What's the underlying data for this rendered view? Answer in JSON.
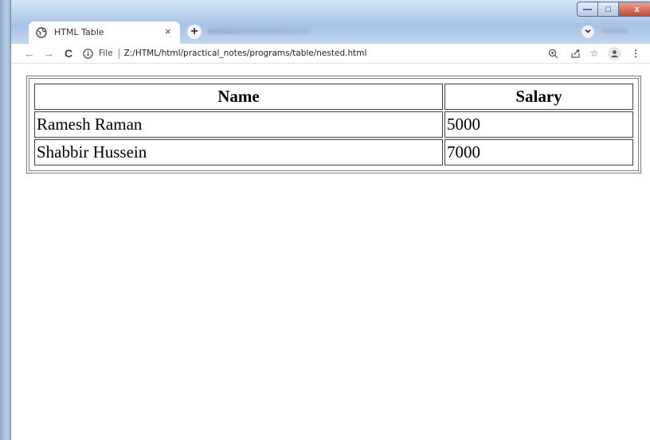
{
  "browser": {
    "tab": {
      "title": "HTML Table",
      "close_glyph": "×"
    },
    "new_tab_glyph": "+",
    "toolbar": {
      "back_glyph": "←",
      "forward_glyph": "→",
      "reload_glyph": "C",
      "scheme_label": "File",
      "url": "Z:/HTML/html/practical_notes/programs/table/nested.html",
      "zoom_icon": "zoom-icon",
      "share_icon": "share-icon",
      "star_glyph": "☆",
      "menu_glyph": "⋮"
    },
    "window_controls": {
      "minimize_glyph": "—",
      "maximize_glyph": "□",
      "close_glyph": "x"
    }
  },
  "page": {
    "table": {
      "headers": [
        "Name",
        "Salary"
      ],
      "rows": [
        [
          "Ramesh Raman",
          "5000"
        ],
        [
          "Shabbir Hussein",
          "7000"
        ]
      ]
    }
  },
  "colors": {
    "frame_blue": "#a9c3e3",
    "close_red": "#c94a33",
    "table_border": "#3f3f3f"
  }
}
